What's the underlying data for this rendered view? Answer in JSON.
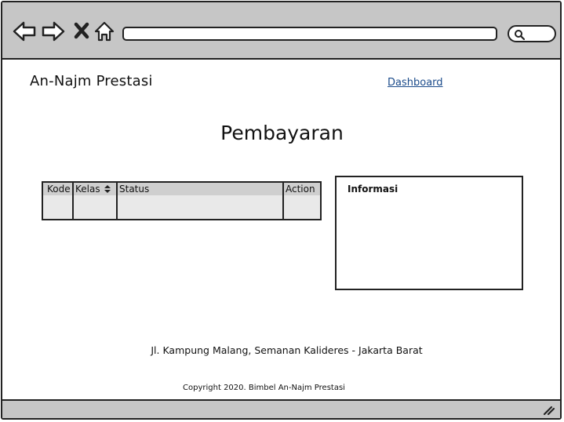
{
  "browser": {
    "nav_icons": [
      "back-arrow-icon",
      "forward-arrow-icon",
      "close-icon",
      "home-icon"
    ],
    "url": "",
    "search_icon": "search-icon"
  },
  "header": {
    "brand": "An-Najm Prestasi",
    "nav_link": "Dashboard"
  },
  "main": {
    "title": "Pembayaran",
    "table": {
      "columns": [
        "Kode",
        "Kelas",
        "Status",
        "Action"
      ],
      "sortable_column_icon": "sort-icon",
      "rows": []
    },
    "info_panel": {
      "title": "Informasi"
    }
  },
  "footer": {
    "address": "Jl. Kampung Malang, Semanan Kalideres - Jakarta Barat",
    "copyright": "Copyright 2020. Bimbel An-Najm Prestasi"
  },
  "colors": {
    "toolbar": "#c6c6c6",
    "table_header": "#cfcfcf",
    "table_body": "#e9e9e9",
    "link": "#1a4a8a"
  }
}
